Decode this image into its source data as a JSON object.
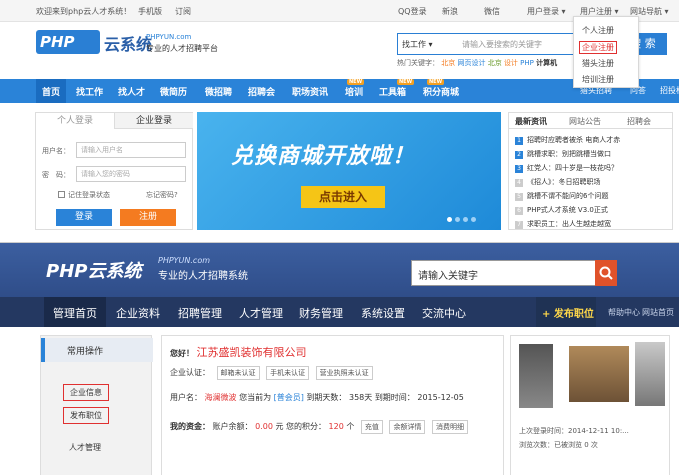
{
  "top": {
    "topbar": {
      "welcome": "欢迎来到php云人才系统！",
      "mobile": "手机版",
      "subscribe": "订阅",
      "qq_login": "QQ登录",
      "weibo": "新浪",
      "weixin": "微信",
      "user_login": "用户登录 ▾",
      "user_register": "用户注册 ▾",
      "site_nav": "网站导航 ▾"
    },
    "register_menu": [
      "个人注册",
      "企业注册",
      "猎头注册",
      "培训注册"
    ],
    "logo": {
      "text": "PHP云系统",
      "url": "PHPYUN.com",
      "slogan": "专业的人才招聘平台"
    },
    "search": {
      "category": "找工作 ▾",
      "placeholder": "请输入要搜索的关键字",
      "button": "搜 索"
    },
    "hot_words": {
      "label": "热门关键字：",
      "words": [
        "北京",
        "网页设计",
        "北京",
        "设计",
        "PHP",
        "计算机"
      ]
    },
    "nav": [
      {
        "label": "首页",
        "new": ""
      },
      {
        "label": "找工作",
        "new": ""
      },
      {
        "label": "找人才",
        "new": ""
      },
      {
        "label": "微简历",
        "new": ""
      },
      {
        "label": "微招聘",
        "new": ""
      },
      {
        "label": "招聘会",
        "new": ""
      },
      {
        "label": "职场资讯",
        "new": ""
      },
      {
        "label": "培训",
        "new": "NEW"
      },
      {
        "label": "工具箱",
        "new": "NEW"
      },
      {
        "label": "积分商城",
        "new": "NEW"
      }
    ],
    "nav_right": [
      "猎头招聘",
      "问答",
      "招投标"
    ],
    "login_box": {
      "tab_personal": "个人登录",
      "tab_company": "企业登录",
      "user_label": "用户名：",
      "user_placeholder": "请输入用户名",
      "pass_label": "密　码：",
      "pass_placeholder": "请输入您的密码",
      "remember": "记住登录状态",
      "forgot": "忘记密码?",
      "login_btn": "登录",
      "register_btn": "注册"
    },
    "banner": {
      "title": "兑换商城开放啦！",
      "button": "点击进入"
    },
    "news_box": {
      "tabs": [
        "最新资讯",
        "网站公告",
        "招聘会"
      ],
      "items": [
        {
          "num": "1",
          "text": "招聘时应聘者被杀  电商人才赤"
        },
        {
          "num": "2",
          "text": "跳槽求职：别把跳槽当做口"
        },
        {
          "num": "3",
          "text": "红党人：四十岁是一枝花吗？"
        },
        {
          "num": "4",
          "text": "《招人》：冬日招聘职场"
        },
        {
          "num": "5",
          "text": "跳槽不谓不能问的6个问题"
        },
        {
          "num": "6",
          "text": "PHP式人才系统 V3.0正式"
        },
        {
          "num": "7",
          "text": "求职员工：出人生越走越宽"
        }
      ]
    }
  },
  "bottom": {
    "logo": {
      "text": "PHP云系统",
      "url": "PHPYUN.com",
      "slogan": "专业的人才招聘系统"
    },
    "search_placeholder": "请输入关键字",
    "nav": [
      "管理首页",
      "企业资料",
      "招聘管理",
      "人才管理",
      "财务管理",
      "系统设置",
      "交流中心"
    ],
    "post_job": "+ 发布职位",
    "nav_links": [
      "帮助中心",
      "网站首页"
    ],
    "sidebar": {
      "title": "常用操作",
      "items": [
        "企业信息",
        "发布职位",
        "人才管理"
      ]
    },
    "main": {
      "greeting": "您好！",
      "company": "江苏盛凯装饰有限公司",
      "cert_label": "企业认证：",
      "cert_items": [
        "邮箱未认证",
        "手机未认证",
        "营业执照未认证"
      ],
      "user_label": "用户名：",
      "username": "海澜微波",
      "rank_label": "您当前为",
      "rank": "[普会员]",
      "days_label": "到期天数：",
      "days": "358天",
      "expire_label": "到期时间：",
      "expire": "2015-12-05",
      "funds_label": "我的资金：",
      "balance_label": "账户余额：",
      "balance": "0.00",
      "balance_unit": "元",
      "points_label": "您的积分：",
      "points": "120",
      "points_unit": "个",
      "actions": [
        "充值",
        "余额详情",
        "消费明细"
      ]
    },
    "right": {
      "last_login_label": "上次登录时间：",
      "last_login": "2014-12-11 10:...",
      "views_label": "浏览次数：",
      "views": "已被浏览 0 次"
    }
  },
  "colors": {
    "primary": "#2a83d8",
    "accent": "#f47b20",
    "header2": "#2f4d89",
    "nav2": "#243861",
    "highlight": "#e03030"
  }
}
